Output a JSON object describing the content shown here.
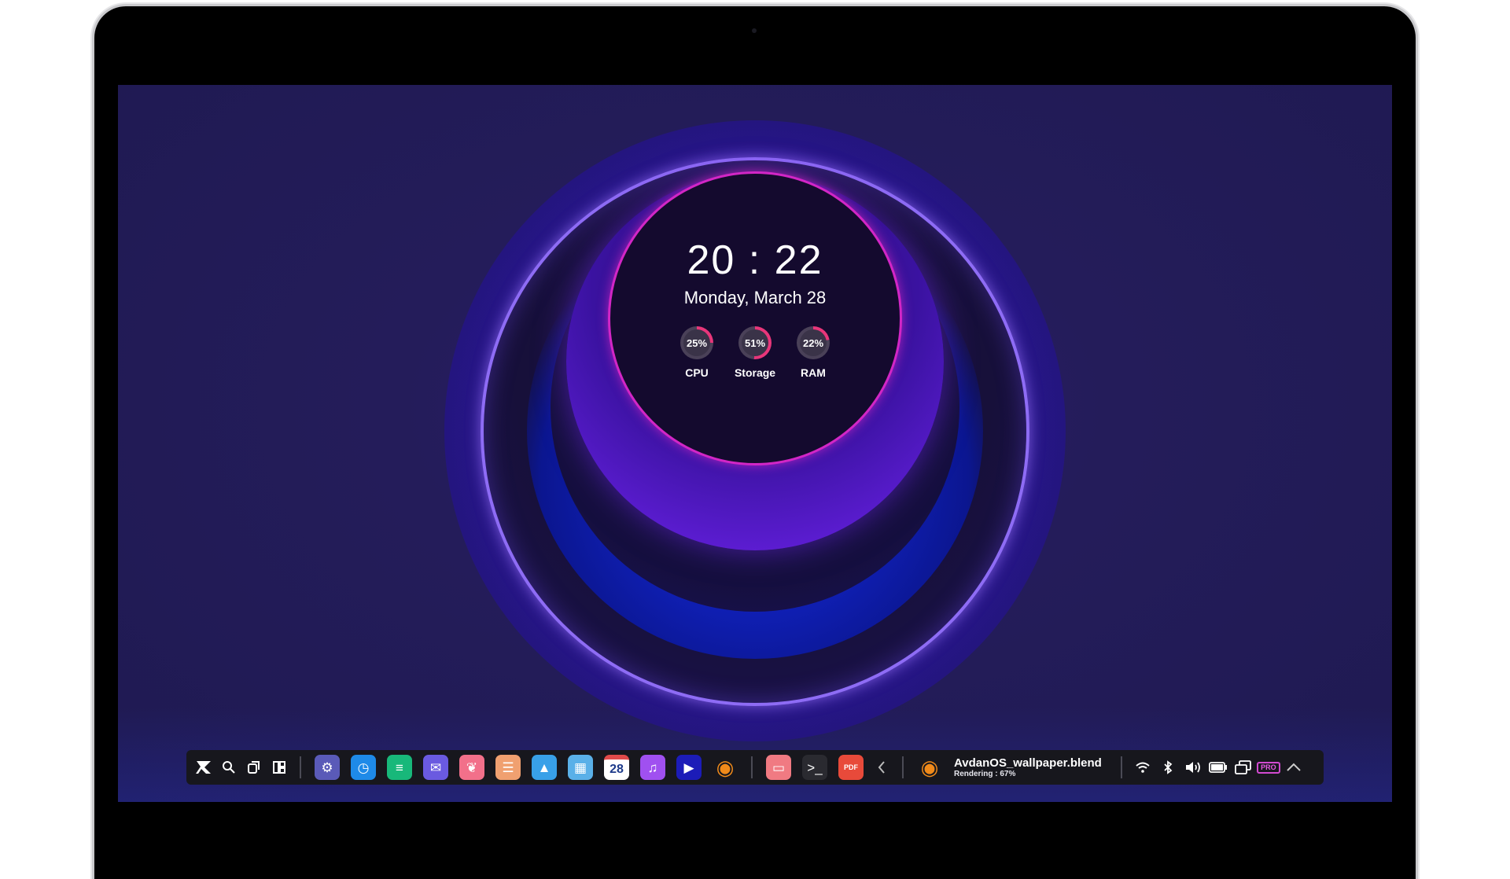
{
  "widget": {
    "time": "20 : 22",
    "date": "Monday, March 28",
    "stats": [
      {
        "label": "CPU",
        "value_text": "25%",
        "value": 25
      },
      {
        "label": "Storage",
        "value_text": "51%",
        "value": 51
      },
      {
        "label": "RAM",
        "value_text": "22%",
        "value": 22
      }
    ]
  },
  "taskbar": {
    "start_icon": "avdan-logo-icon",
    "search_icon": "search-icon",
    "task_view_icon": "task-view-icon",
    "widgets_icon": "widgets-icon",
    "apps": [
      {
        "name": "settings-icon",
        "glyph": "⚙",
        "color": "#5a5ab8"
      },
      {
        "name": "clock-icon",
        "glyph": "◷",
        "color": "#1e8ae8"
      },
      {
        "name": "messages-icon",
        "glyph": "≡",
        "color": "#18b87a"
      },
      {
        "name": "mail-icon",
        "glyph": "✉",
        "color": "#6a5ae0"
      },
      {
        "name": "browser-icon",
        "glyph": "❦",
        "color": "#f2708a"
      },
      {
        "name": "notes-icon",
        "glyph": "☰",
        "color": "#f0a070"
      },
      {
        "name": "photos-icon",
        "glyph": "▲",
        "color": "#38a0e8"
      },
      {
        "name": "calculator-icon",
        "glyph": "▦",
        "color": "#5ab0e8"
      },
      {
        "name": "calendar-icon",
        "glyph": "28",
        "color": "#ffffff"
      },
      {
        "name": "music-icon",
        "glyph": "♫",
        "color": "#a050f0"
      },
      {
        "name": "media-player-icon",
        "glyph": "▶",
        "color": "#1c1cb8"
      },
      {
        "name": "blender-icon",
        "glyph": "◉",
        "color": "#f08a1a"
      }
    ],
    "pinned_apps": [
      {
        "name": "files-icon",
        "glyph": "▭",
        "color": "#f07a82"
      },
      {
        "name": "terminal-icon",
        "glyph": ">_",
        "color": "#2a2a30"
      },
      {
        "name": "pdf-reader-icon",
        "glyph": "PDF",
        "color": "#e84a3a"
      }
    ],
    "collapse_icon": "chevron-left-icon",
    "active_task": {
      "icon": "blender-icon",
      "title": "AvdanOS_wallpaper.blend",
      "status": "Rendering : 67%"
    },
    "tray": {
      "wifi_icon": "wifi-icon",
      "bluetooth_icon": "bluetooth-icon",
      "volume_icon": "volume-icon",
      "battery_icon": "battery-icon",
      "display_icon": "display-icon",
      "pro_badge": "PRO",
      "expand_icon": "chevron-up-icon"
    }
  },
  "colors": {
    "gauge_track": "#4a4158",
    "gauge_fill": "#e8367a",
    "accent_ring": "#8e6cf5",
    "inner_ring": "#d226c6"
  }
}
